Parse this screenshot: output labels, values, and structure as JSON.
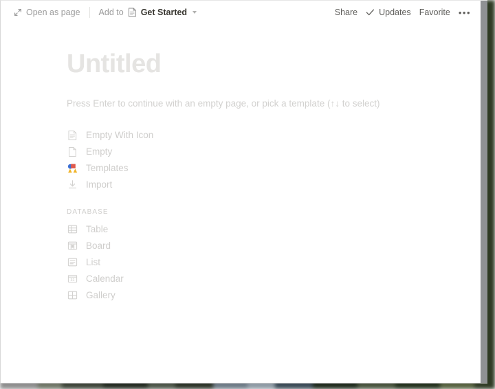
{
  "window": {
    "kind": "notion-page-peek-overlay"
  },
  "toolbar": {
    "open_as_page": {
      "label": "Open as page",
      "icon": "expand-diagonal-icon"
    },
    "add_to": {
      "prefix_label": "Add to",
      "destination_label": "Get Started",
      "destination_icon": "page-document-icon",
      "chevron_icon": "chevron-down-icon"
    },
    "share_label": "Share",
    "updates": {
      "label": "Updates",
      "icon": "check-icon"
    },
    "favorite_label": "Favorite",
    "more_label": "•••"
  },
  "page": {
    "title": "Untitled",
    "hint": "Press Enter to continue with an empty page, or pick a template (↑↓ to select)"
  },
  "options": [
    {
      "label": "Empty With Icon",
      "icon": "document-with-lines-icon"
    },
    {
      "label": "Empty",
      "icon": "blank-document-icon"
    },
    {
      "label": "Templates",
      "icon": "templates-shapes-icon"
    },
    {
      "label": "Import",
      "icon": "import-download-icon"
    }
  ],
  "database_section": {
    "header": "Database",
    "items": [
      {
        "label": "Table",
        "icon": "table-grid-icon"
      },
      {
        "label": "Board",
        "icon": "board-kanban-icon"
      },
      {
        "label": "List",
        "icon": "list-lines-icon"
      },
      {
        "label": "Calendar",
        "icon": "calendar-31-icon"
      },
      {
        "label": "Gallery",
        "icon": "gallery-grid-icon"
      }
    ]
  },
  "colors": {
    "title_gray": "#e5e4e2",
    "muted_text": "#cfcecc",
    "strong_text": "#37352f",
    "toolbar_text": "#5f5e5b",
    "icon_gray": "#d4d3d1",
    "template_blue": "#3b6fd4",
    "template_red": "#e05a4b",
    "template_yellow": "#f0b429",
    "overlay_edge": "#8f9194"
  }
}
